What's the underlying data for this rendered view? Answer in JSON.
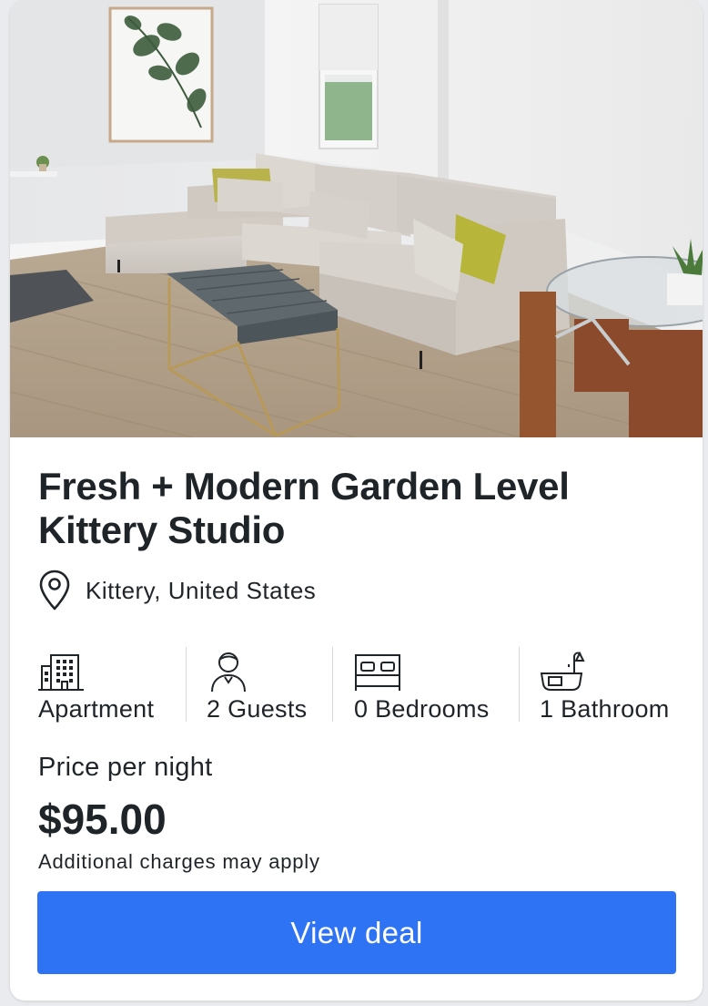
{
  "listing": {
    "photo_alt": "Living room with sectional sofa, upholstered bench and glass dining table",
    "title": "Fresh + Modern Garden Level Kittery Studio",
    "location": "Kittery, United States"
  },
  "amenities": [
    {
      "icon": "building-icon",
      "label": "Apartment"
    },
    {
      "icon": "guest-icon",
      "label": "2 Guests"
    },
    {
      "icon": "bed-icon",
      "label": "0 Bedrooms"
    },
    {
      "icon": "bathtub-icon",
      "label": "1 Bathroom"
    }
  ],
  "pricing": {
    "label": "Price per night",
    "price": "$95.00",
    "note": "Additional charges may apply"
  },
  "cta": {
    "label": "View deal"
  },
  "colors": {
    "text": "#1f2428",
    "button": "#2d73f3",
    "button_text": "#ffffff",
    "divider": "#d5d8dc"
  }
}
